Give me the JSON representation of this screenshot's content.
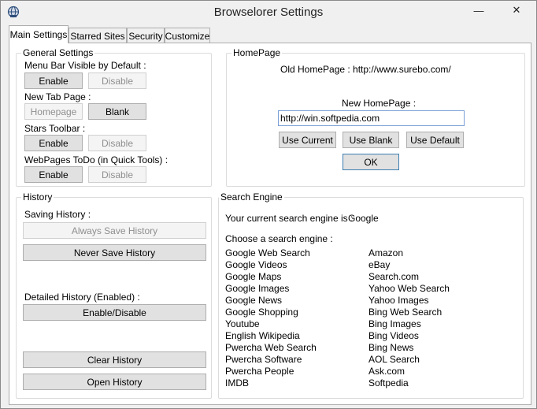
{
  "window": {
    "title": "Browselorer Settings",
    "minimize_glyph": "—",
    "close_glyph": "✕"
  },
  "tabs": [
    {
      "label": "Main Settings",
      "active": true
    },
    {
      "label": "Starred Sites",
      "active": false
    },
    {
      "label": "Security",
      "active": false
    },
    {
      "label": "Customize",
      "active": false
    }
  ],
  "general": {
    "title": "General Settings",
    "menu_bar_label": "Menu Bar Visible by Default :",
    "menu_enable": "Enable",
    "menu_disable": "Disable",
    "new_tab_label": "New Tab Page :",
    "tab_homepage": "Homepage",
    "tab_blank": "Blank",
    "stars_label": "Stars Toolbar :",
    "stars_enable": "Enable",
    "stars_disable": "Disable",
    "todo_label": "WebPages ToDo (in Quick Tools) :",
    "todo_enable": "Enable",
    "todo_disable": "Disable"
  },
  "homepage": {
    "title": "HomePage",
    "old_label": "Old HomePage : http://www.surebo.com/",
    "new_label": "New HomePage :",
    "new_value": "http://win.softpedia.com",
    "use_current": "Use Current",
    "use_blank": "Use Blank",
    "use_default": "Use Default",
    "ok": "OK"
  },
  "history": {
    "title": "History",
    "saving_label": "Saving History :",
    "always_save": "Always Save History",
    "never_save": "Never Save History",
    "detailed_label": "Detailed History (Enabled) :",
    "enable_disable": "Enable/Disable",
    "clear": "Clear History",
    "open": "Open History"
  },
  "search": {
    "title": "Search Engine",
    "current_label": "Your current search engine is :",
    "current_value": "Google",
    "choose_label": "Choose a search engine :",
    "left_engines": [
      "Google Web Search",
      "Google Videos",
      "Google Maps",
      "Google Images",
      "Google News",
      "Google Shopping",
      "Youtube",
      "English Wikipedia",
      "Pwercha Web Search",
      "Pwercha Software",
      "Pwercha People",
      "IMDB"
    ],
    "right_engines": [
      "Amazon",
      "eBay",
      "Search.com",
      "Yahoo Web Search",
      "Yahoo Images",
      "Bing Web Search",
      "Bing Images",
      "Bing Videos",
      "Bing News",
      "AOL Search",
      "Ask.com",
      "Softpedia"
    ]
  }
}
